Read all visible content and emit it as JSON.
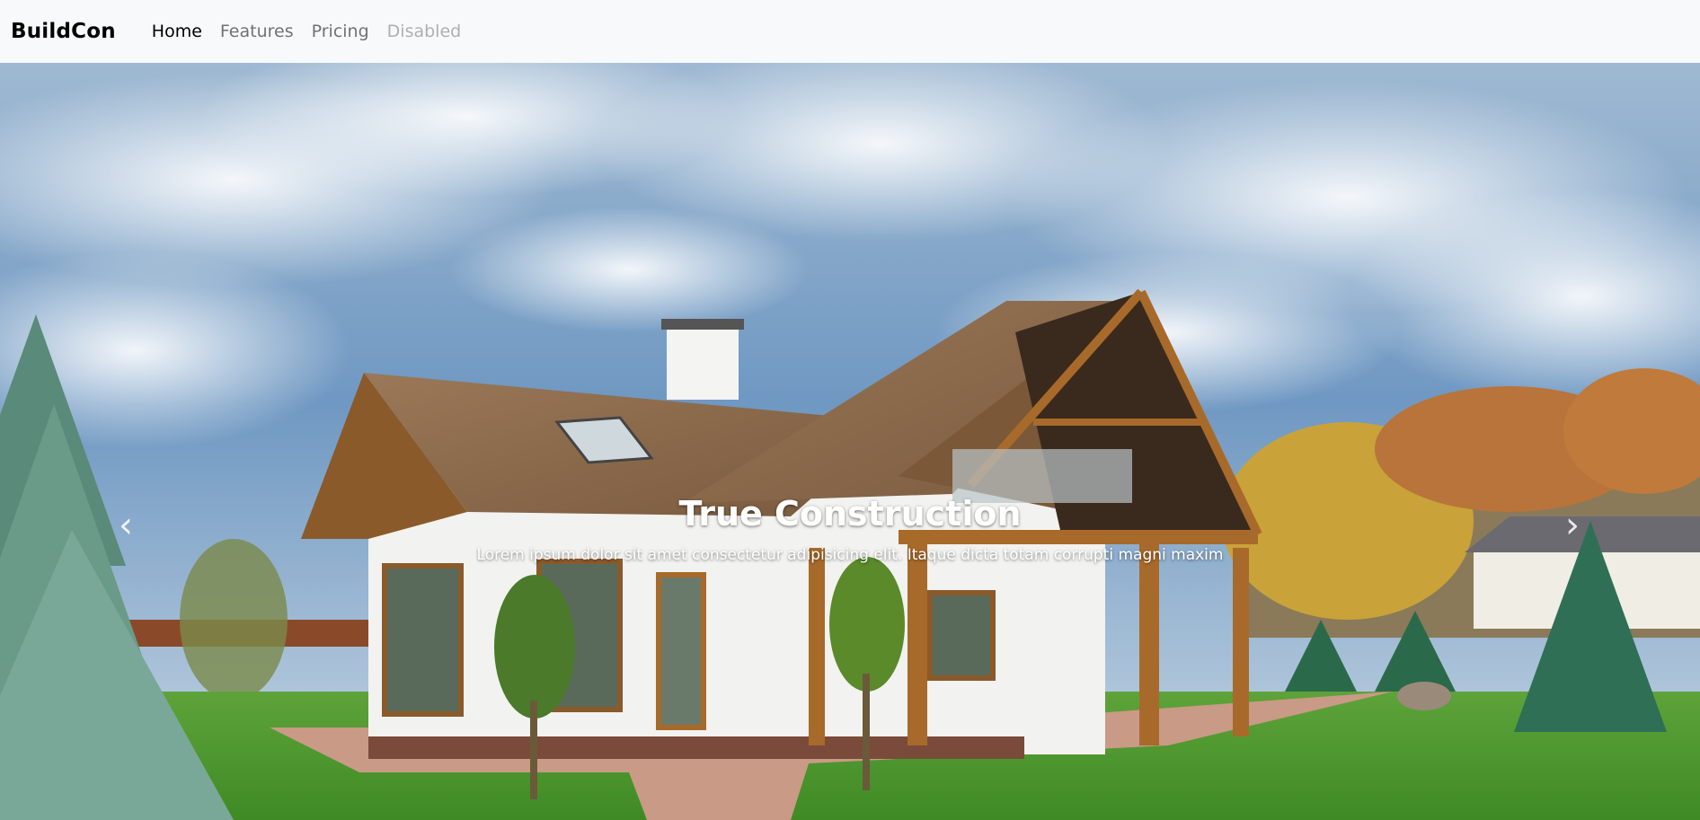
{
  "navbar": {
    "brand": "BuildCon",
    "links": [
      {
        "label": "Home",
        "state": "active"
      },
      {
        "label": "Features",
        "state": "normal"
      },
      {
        "label": "Pricing",
        "state": "normal"
      },
      {
        "label": "Disabled",
        "state": "disabled"
      }
    ]
  },
  "carousel": {
    "slide": {
      "title": "True Construction",
      "text": "Lorem ipsum dolor sit amet consectetur adipisicing elit. Itaque dicta totam corrupti magni maxim"
    },
    "prev_icon": "chevron-left-icon",
    "next_icon": "chevron-right-icon"
  },
  "colors": {
    "navbar_bg": "#f8f9fa",
    "brand": "#000000",
    "sky": "#4a7fb3",
    "grass": "#4f9a2e",
    "roof": "#8a6a4c",
    "wall": "#f2f2f0",
    "wood": "#a86a2a"
  }
}
